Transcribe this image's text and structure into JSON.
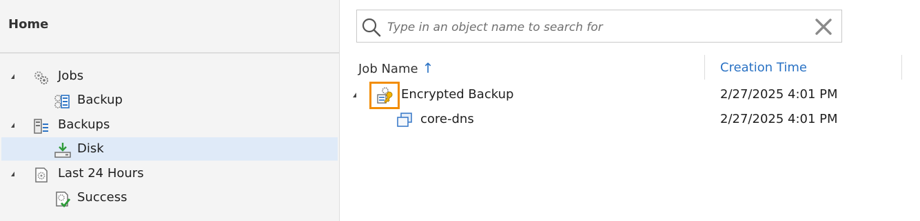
{
  "nav": {
    "title": "Home",
    "items": [
      {
        "label": "Jobs",
        "icon": "gears-icon",
        "expanded": true,
        "level": 0
      },
      {
        "label": "Backup",
        "icon": "backup-job-icon",
        "level": 1
      },
      {
        "label": "Backups",
        "icon": "backups-icon",
        "expanded": true,
        "level": 0
      },
      {
        "label": "Disk",
        "icon": "disk-icon",
        "level": 1,
        "selected": true
      },
      {
        "label": "Last 24 Hours",
        "icon": "last-24-hours-icon",
        "expanded": true,
        "level": 0
      },
      {
        "label": "Success",
        "icon": "success-icon",
        "level": 1
      }
    ]
  },
  "search": {
    "placeholder": "Type in an object name to search for",
    "value": ""
  },
  "table": {
    "columns": [
      "Job Name",
      "Creation Time"
    ],
    "sort_arrow": "↑",
    "rows": [
      {
        "name": "Encrypted Backup",
        "time": "2/27/2025 4:01 PM",
        "icon": "encrypted-backup-icon",
        "expanded": true,
        "level": 0
      },
      {
        "name": "core-dns",
        "time": "2/27/2025 4:01 PM",
        "icon": "vm-object-icon",
        "level": 1
      }
    ]
  },
  "colors": {
    "accent_blue": "#2a72c4",
    "selection": "#dfeaf8",
    "highlight_orange": "#f28c00"
  }
}
